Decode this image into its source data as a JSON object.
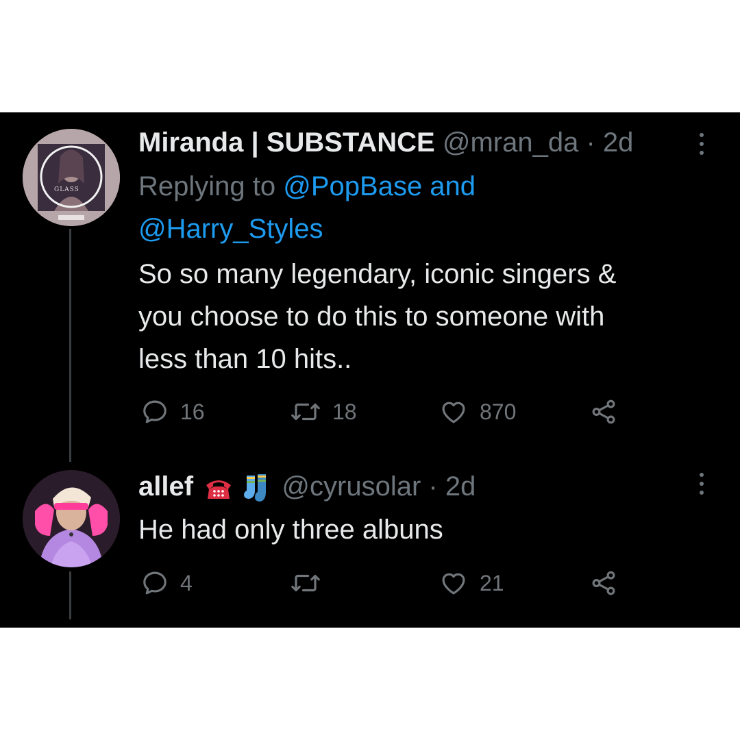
{
  "tweets": [
    {
      "display_name": "Miranda | SUBSTANCE",
      "handle": "@mran_da",
      "separator": " · ",
      "age": "2d",
      "replying_prefix": "Replying to ",
      "mention_1": "@PopBase",
      "mention_join": " and",
      "mention_2": "@Harry_Styles",
      "text_lines": [
        "So so many legendary, iconic singers &",
        "you choose to do this to someone with",
        "less than 10 hits.."
      ],
      "replies": "16",
      "retweets": "18",
      "likes": "870",
      "avatar_caption": "GLASS"
    },
    {
      "display_name": "allef",
      "emoji": [
        "telephone-emoji",
        "socks-emoji"
      ],
      "handle": "@cyrusolar",
      "separator": " · ",
      "age": "2d",
      "text": "He had only three albuns",
      "replies": "4",
      "retweets": "",
      "likes": "21"
    }
  ],
  "colors": {
    "background": "#000000",
    "primary_text": "#e7e9ea",
    "secondary_text": "#6e767d",
    "link": "#1d9bf0"
  },
  "icons": [
    "reply-icon",
    "retweet-icon",
    "like-icon",
    "share-icon",
    "more-icon"
  ]
}
